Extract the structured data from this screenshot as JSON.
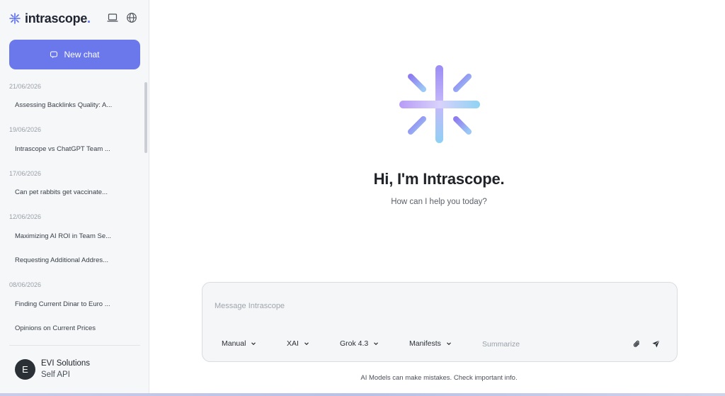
{
  "brand": {
    "name": "intrascope",
    "dot": "."
  },
  "icons": {
    "brand_logo": "asterisk-logo-icon",
    "device": "laptop-icon",
    "language": "globe-icon",
    "new_chat": "chat-bubble-icon",
    "attach": "paperclip-icon",
    "send": "send-icon"
  },
  "colors": {
    "accent": "#6b78ec",
    "brand_dot": "#5b6cf0",
    "avatar_bg": "#2b2f36"
  },
  "sidebar": {
    "new_chat_label": "New chat",
    "history": [
      {
        "date": "21/06/2026",
        "items": [
          "Assessing Backlinks Quality: A..."
        ]
      },
      {
        "date": "19/06/2026",
        "items": [
          "Intrascope vs ChatGPT Team ..."
        ]
      },
      {
        "date": "17/06/2026",
        "items": [
          "Can pet rabbits get vaccinate..."
        ]
      },
      {
        "date": "12/06/2026",
        "items": [
          "Maximizing AI ROI in Team Se...",
          "Requesting Additional Addres..."
        ]
      },
      {
        "date": "08/06/2026",
        "items": [
          "Finding Current Dinar to Euro ...",
          "Opinions on Current Prices"
        ]
      }
    ],
    "user": {
      "initial": "E",
      "name": "EVI Solutions",
      "subtitle": "Self API"
    }
  },
  "main": {
    "greeting": "Hi, I'm Intrascope.",
    "subtitle": "How can I help you today?",
    "composer": {
      "placeholder": "Message Intrascope",
      "mode": "Manual",
      "provider": "XAI",
      "model": "Grok 4.3",
      "manifests": "Manifests",
      "summarize": "Summarize"
    },
    "disclaimer": "AI Models can make mistakes. Check important info."
  }
}
